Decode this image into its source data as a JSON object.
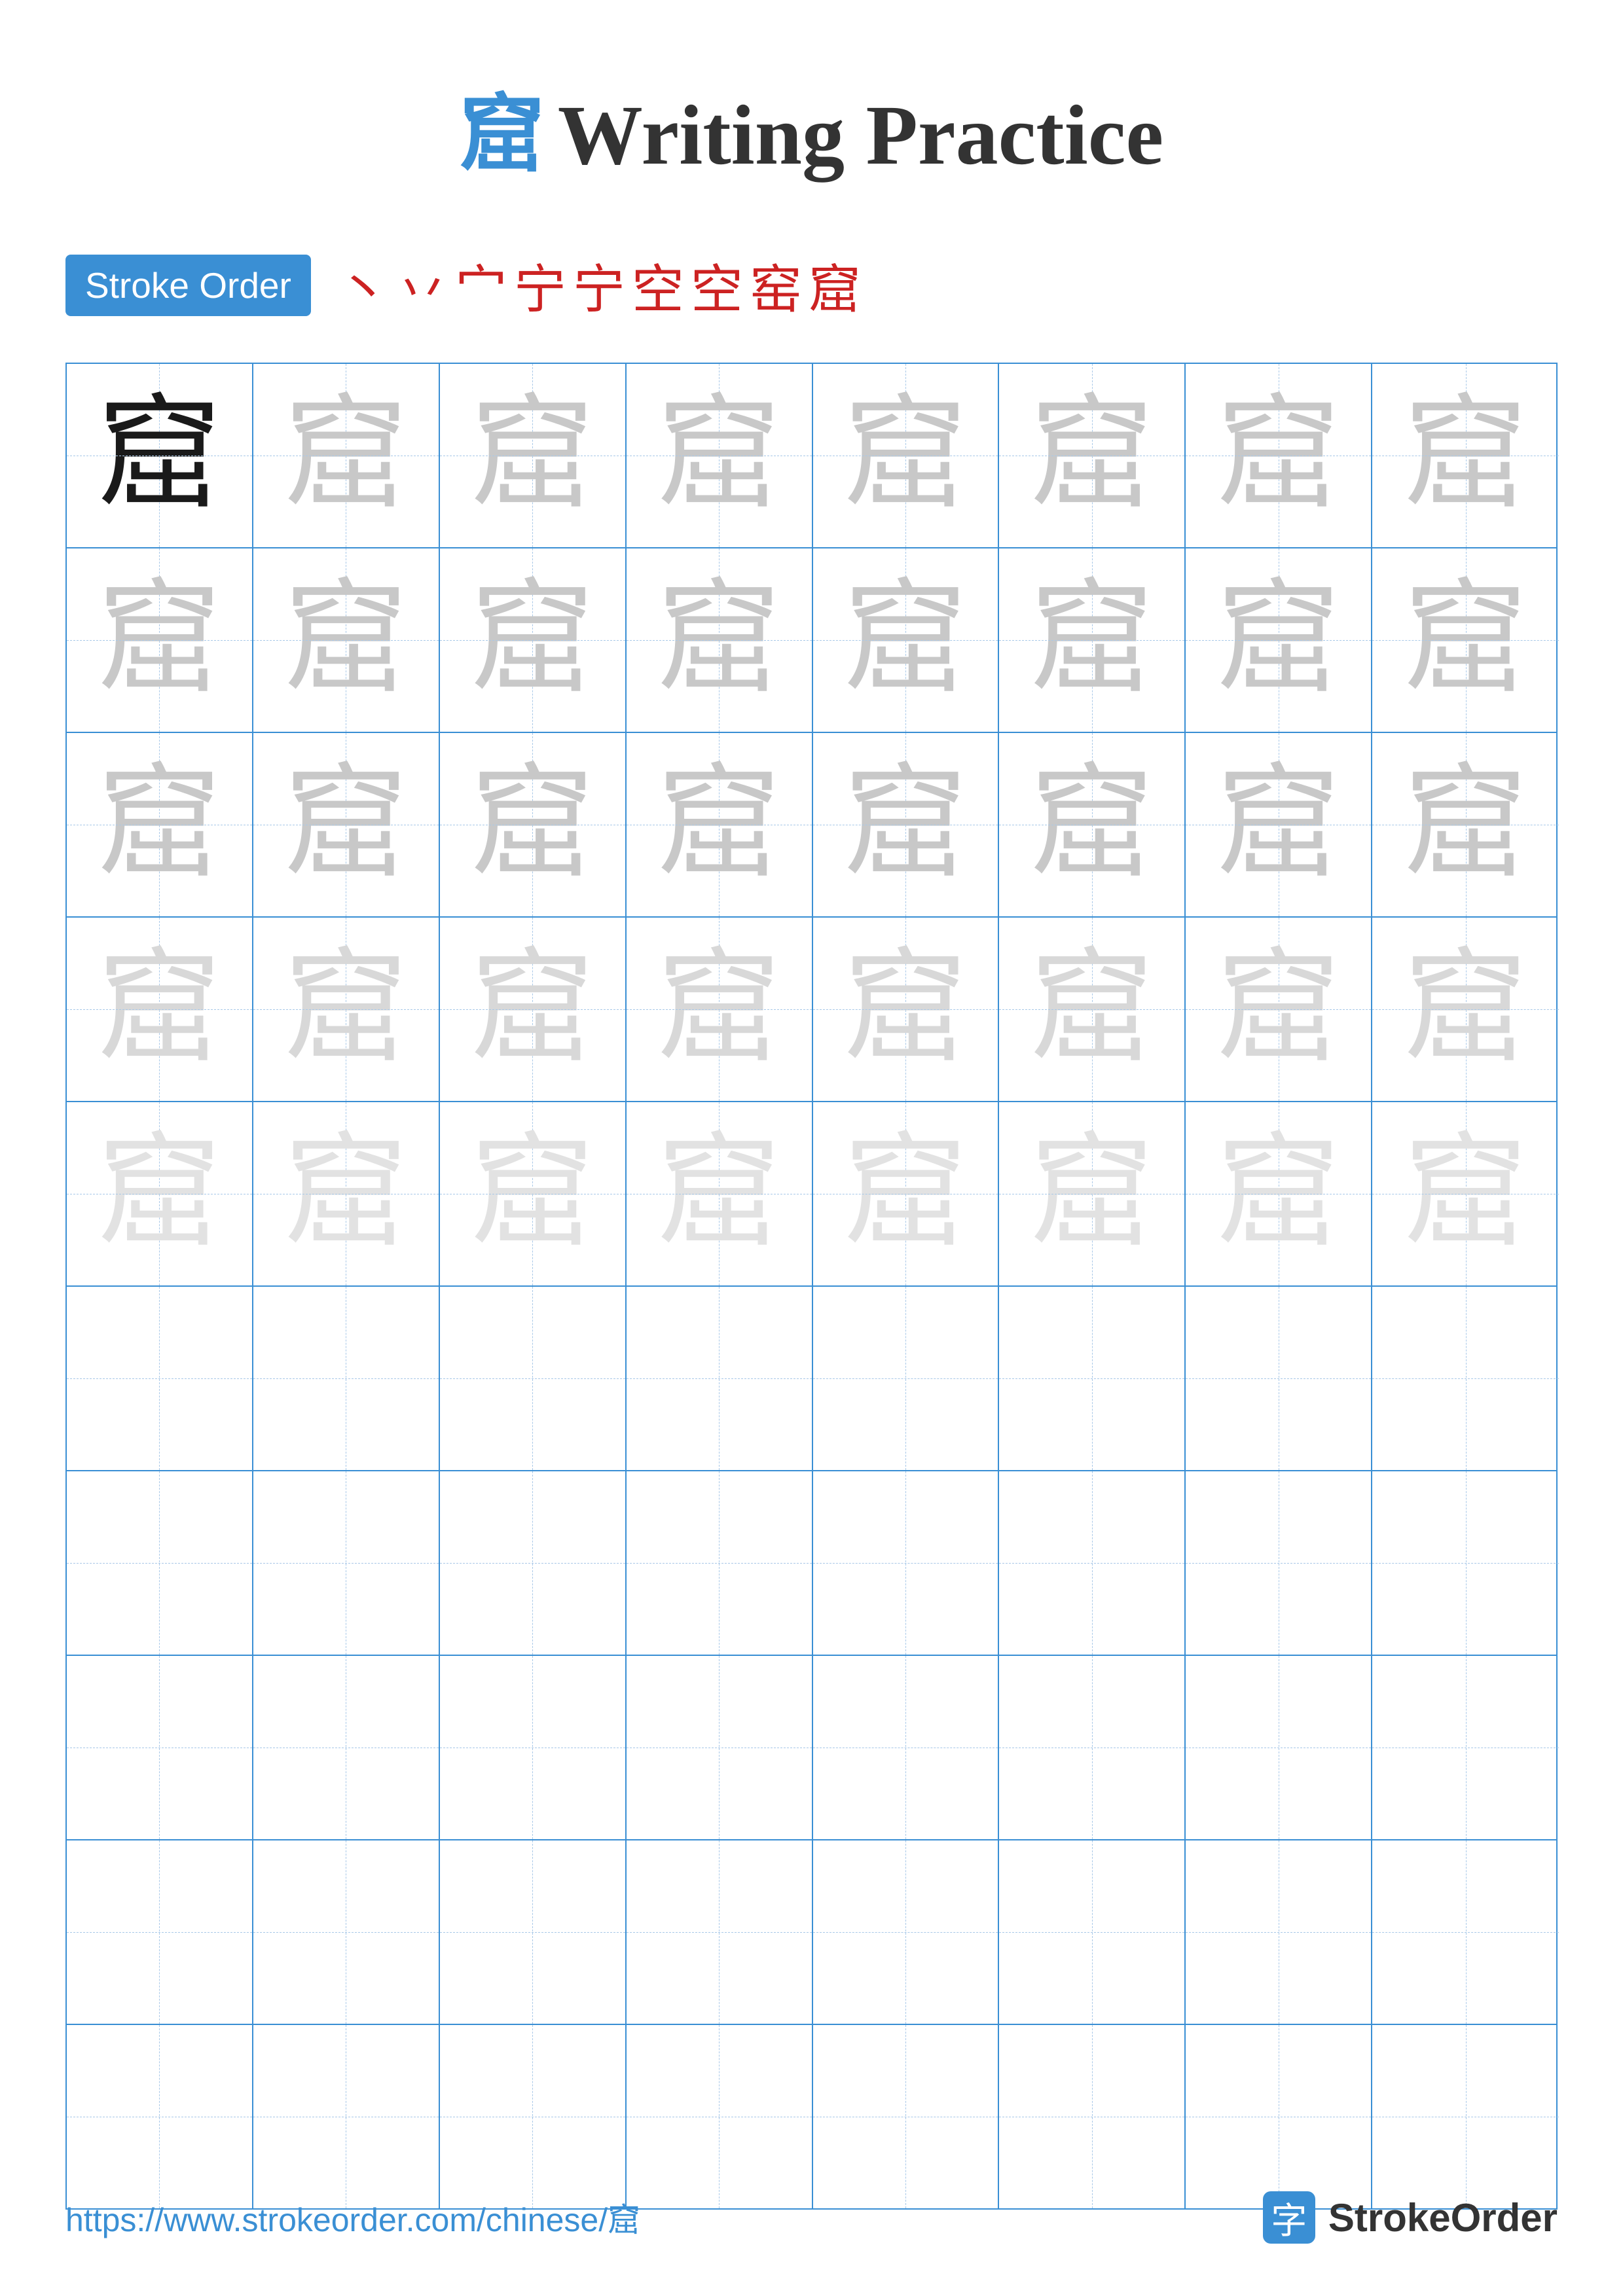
{
  "title": {
    "char": "窟",
    "text": "Writing Practice"
  },
  "stroke_order": {
    "badge_label": "Stroke Order",
    "strokes": [
      "丶",
      "丷",
      "宀",
      "宁",
      "宁",
      "空",
      "空",
      "窑",
      "窟"
    ]
  },
  "grid": {
    "character": "窟",
    "rows": 10,
    "cols": 8,
    "filled_rows": 5,
    "empty_rows": 5
  },
  "footer": {
    "url": "https://www.strokeorder.com/chinese/窟",
    "brand_char": "字",
    "brand_name": "StrokeOrder"
  }
}
